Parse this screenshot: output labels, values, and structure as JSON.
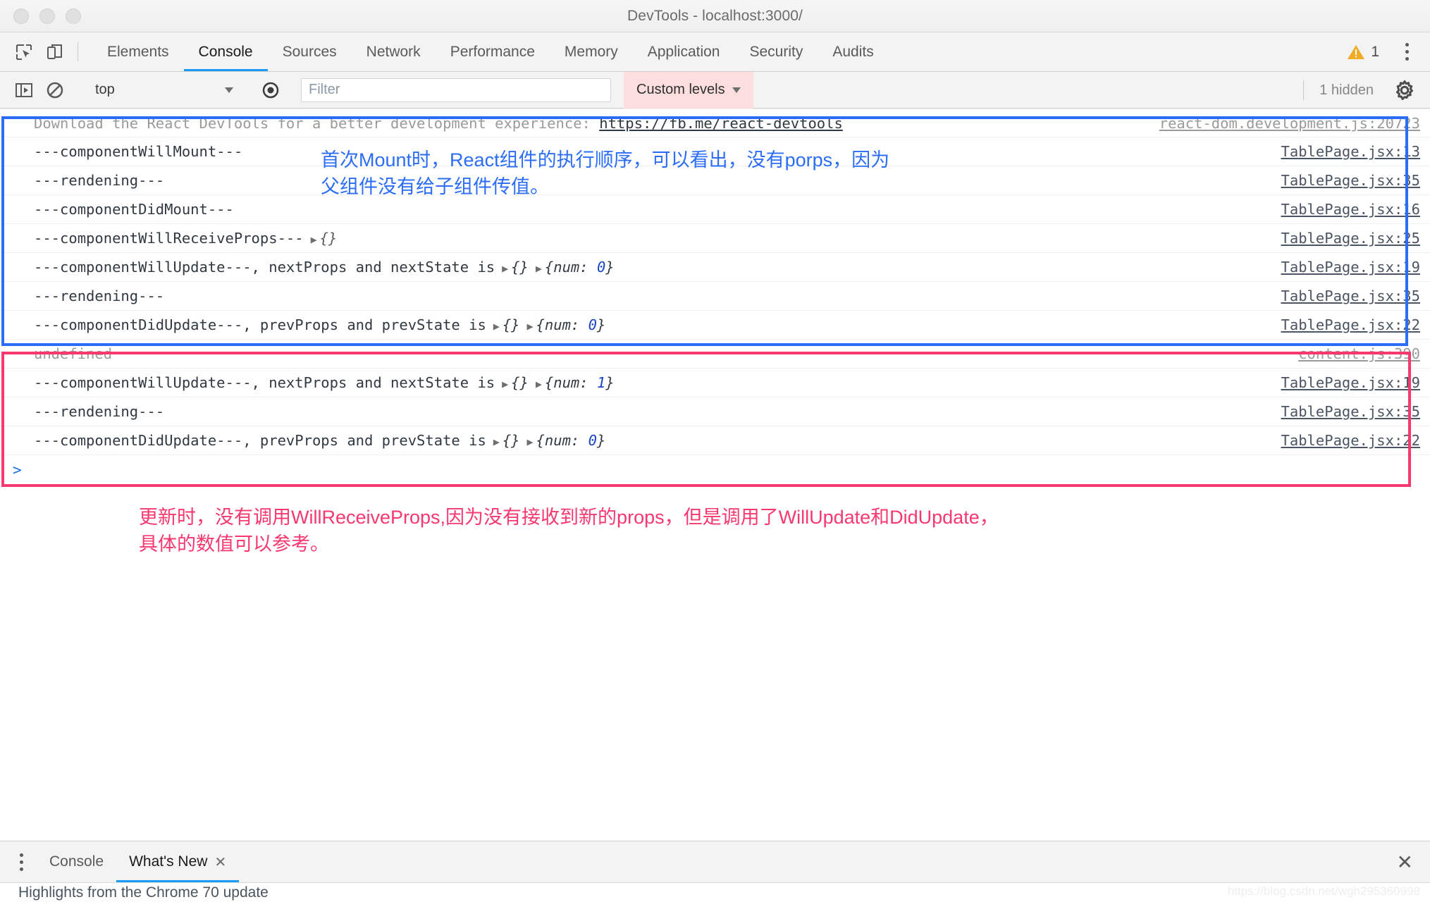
{
  "window": {
    "title": "DevTools - localhost:3000/"
  },
  "tabstrip": {
    "inspect_icon": "inspect-element-icon",
    "device_icon": "device-toolbar-icon",
    "tabs": [
      {
        "label": "Elements",
        "active": false
      },
      {
        "label": "Console",
        "active": true
      },
      {
        "label": "Sources",
        "active": false
      },
      {
        "label": "Network",
        "active": false
      },
      {
        "label": "Performance",
        "active": false
      },
      {
        "label": "Memory",
        "active": false
      },
      {
        "label": "Application",
        "active": false
      },
      {
        "label": "Security",
        "active": false
      },
      {
        "label": "Audits",
        "active": false
      }
    ],
    "warning_count": "1",
    "warning_color": "#f2ab26",
    "more_label": "⋮"
  },
  "console_toolbar": {
    "sidebar_icon": "console-sidebar-icon",
    "clear_icon": "clear-console-icon",
    "context": "top",
    "eye_icon": "live-expression-icon",
    "filter_placeholder": "Filter",
    "filter_value": "",
    "level_label": "Custom levels",
    "level_highlight_color": "#fbdedd",
    "hidden_label": "1 hidden",
    "settings_icon": "gear-icon"
  },
  "console_logs": [
    {
      "id": "react-devtools-notice",
      "text_before": "Download the React DevTools for a better development experience: ",
      "link": "https://fb.me/react-devtools",
      "source": "react-dom.development.js:20723",
      "dim": true
    },
    {
      "id": "will-mount",
      "text": "---componentWillMount---",
      "source": "TablePage.jsx:13"
    },
    {
      "id": "rendering-1",
      "text": "---rendening---",
      "source": "TablePage.jsx:35"
    },
    {
      "id": "did-mount",
      "text": "---componentDidMount---",
      "source": "TablePage.jsx:16"
    },
    {
      "id": "will-receive-props",
      "text": "---componentWillReceiveProps---",
      "obj1": "{}",
      "source": "TablePage.jsx:25"
    },
    {
      "id": "will-update-1",
      "text": "---componentWillUpdate---, nextProps and nextState is",
      "obj1": "{}",
      "obj2_key": "num",
      "obj2_value": "0",
      "source": "TablePage.jsx:19"
    },
    {
      "id": "rendering-2",
      "text": "---rendening---",
      "source": "TablePage.jsx:35"
    },
    {
      "id": "did-update-1",
      "text": "---componentDidUpdate---, prevProps and prevState is",
      "obj1": "{}",
      "obj2_key": "num",
      "obj2_value": "0",
      "source": "TablePage.jsx:22"
    },
    {
      "id": "undefined-row",
      "text": "undefined",
      "source": "content.js:390",
      "dim": true
    },
    {
      "id": "will-update-2",
      "text": "---componentWillUpdate---, nextProps and nextState is",
      "obj1": "{}",
      "obj2_key": "num",
      "obj2_value": "1",
      "source": "TablePage.jsx:19"
    },
    {
      "id": "rendering-3",
      "text": "---rendening---",
      "source": "TablePage.jsx:35"
    },
    {
      "id": "did-update-2",
      "text": "---componentDidUpdate---, prevProps and prevState is",
      "obj1": "{}",
      "obj2_key": "num",
      "obj2_value": "0",
      "source": "TablePage.jsx:22"
    }
  ],
  "console_prompt": ">",
  "annotations": {
    "blue": {
      "text": "首次Mount时，React组件的执行顺序，可以看出，没有porps，因为\n父组件没有给子组件传值。",
      "color": "#2b6df6"
    },
    "pink": {
      "text": "更新时，没有调用WillReceiveProps,因为没有接收到新的props，但是调用了WillUpdate和DidUpdate，\n具体的数值可以参考。",
      "color": "#f8386e"
    }
  },
  "drawer": {
    "kebab": "drawer-menu-icon",
    "tabs": [
      {
        "label": "Console",
        "closable": false,
        "active": false
      },
      {
        "label": "What's New",
        "closable": true,
        "close_glyph": "✕",
        "active": true
      }
    ],
    "close_glyph": "✕",
    "content_headline": "Highlights from the Chrome 70 update"
  },
  "watermark": "https://blog.csdn.net/wgh295360998"
}
